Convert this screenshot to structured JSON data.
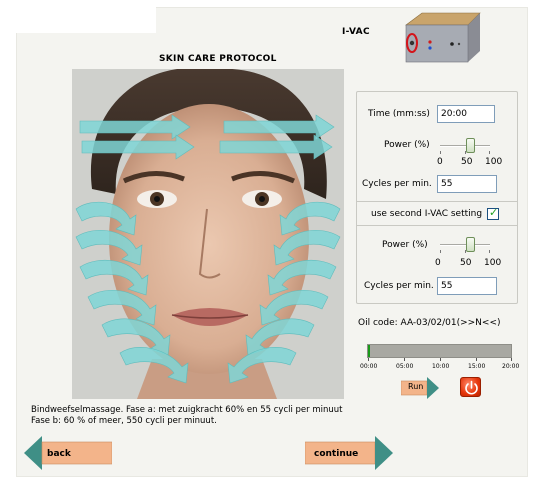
{
  "header": {
    "device_title": "I-VAC",
    "protocol_title": "SKIN CARE PROTOCOL"
  },
  "settings": {
    "time_label": "Time (mm:ss)",
    "time_value": "20:00",
    "power1_label": "Power (%)",
    "power1_value": 60,
    "power1_scale": [
      "0",
      "50",
      "100"
    ],
    "cycles1_label": "Cycles per min.",
    "cycles1_value": "55",
    "second_setting_label": "use second I-VAC setting",
    "second_setting_checked": true,
    "power2_label": "Power (%)",
    "power2_value": 60,
    "power2_scale": [
      "0",
      "50",
      "100"
    ],
    "cycles2_label": "Cycles per min.",
    "cycles2_value": "55"
  },
  "oil_code": "Oil code:  AA-03/02/01(>>N<<)",
  "timeline": {
    "progress": 0.01,
    "labels": [
      "00:00",
      "05:00",
      "10:00",
      "15:00",
      "20:00"
    ]
  },
  "controls": {
    "run_label": "Run",
    "stop_icon": "power-icon"
  },
  "description": {
    "line1": "Bindweefselmassage. Fase a: met zuigkracht 60%  en 55 cycli per minuut",
    "line2": "Fase b:  60 % of meer, 550 cycli per minuut."
  },
  "nav": {
    "back_label": "back",
    "continue_label": "continue"
  },
  "colors": {
    "arrow_fill": "#7fd6d6",
    "nav_button": "#f3b48a",
    "nav_arrow": "#3f8f86",
    "timeline_fill": "#1a9a1a",
    "stop_button": "#e5350b"
  }
}
